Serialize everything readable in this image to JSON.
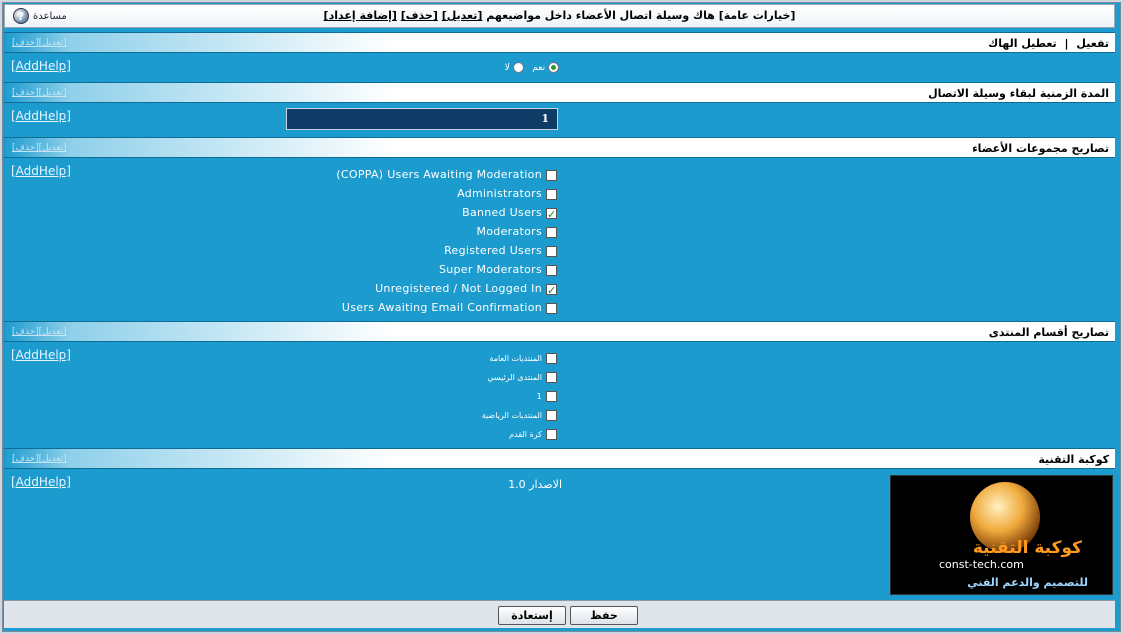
{
  "topbar": {
    "title_prefix": "[خيارات عامة] هاك وسيلة اتصال الأعضاء داخل مواضيعهم",
    "edit_link": "[تعديل]",
    "delete_link": "[حذف]",
    "add_setting_link": "[إضافة إعداد]",
    "help_label": "مساعدة",
    "help_glyph": "?"
  },
  "section_edit": "[تعديل]",
  "section_delete": "[حذف]",
  "add_help": "[AddHelp]",
  "sections": {
    "enable": {
      "label_a": "تفعيل",
      "sep": "|",
      "label_b": "تعطيل الهاك",
      "yes": "نعم",
      "no": "لا",
      "selected": "yes"
    },
    "duration": {
      "label": "المدة الزمنية لبقاء وسيلة الاتصال",
      "value": "1"
    },
    "groups": {
      "label": "تصاريح مجموعات الأعضاء",
      "items": [
        {
          "text": "COPPA) Users Awaiting Moderation)",
          "checked": false
        },
        {
          "text": "Administrators",
          "checked": false
        },
        {
          "text": "Banned Users",
          "checked": true
        },
        {
          "text": "Moderators",
          "checked": false
        },
        {
          "text": "Registered Users",
          "checked": false
        },
        {
          "text": "Super Moderators",
          "checked": false
        },
        {
          "text": "Unregistered / Not Logged In",
          "checked": true
        },
        {
          "text": "Users Awaiting Email Confirmation",
          "checked": false
        }
      ]
    },
    "forums": {
      "label": "تصاريح أقسام المنتدى",
      "items": [
        {
          "text": "المنتديات العامة",
          "checked": false
        },
        {
          "text": "المنتدى الرئيسي",
          "checked": false
        },
        {
          "text": "1",
          "checked": false
        },
        {
          "text": "المنتديات الرياضية",
          "checked": false
        },
        {
          "text": "كرة القدم",
          "checked": false
        }
      ]
    },
    "about": {
      "label": "كوكبة التقنية",
      "version": "الاصدار 1.0",
      "logo_ar": "كوكبة التقنية",
      "logo_en": "const-tech.com",
      "logo_tag": "للتصميم والدعم الفني"
    }
  },
  "footer": {
    "save": "حفظ",
    "restore": "إستعادة"
  }
}
